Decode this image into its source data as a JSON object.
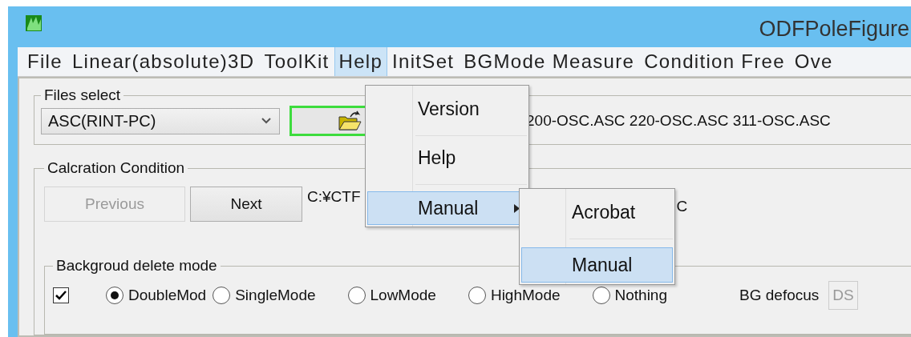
{
  "window": {
    "title": "ODFPoleFigure"
  },
  "menu_bar": [
    {
      "label": "File",
      "selected": false
    },
    {
      "label": "Linear(absolute)3D",
      "selected": false
    },
    {
      "label": "ToolKit",
      "selected": false
    },
    {
      "label": "Help",
      "selected": true
    },
    {
      "label": "InitSet",
      "selected": false
    },
    {
      "label": "BGMode Measure",
      "selected": false
    },
    {
      "label": "Condition Free",
      "selected": false
    },
    {
      "label": "Ove",
      "selected": false
    }
  ],
  "help_menu": [
    {
      "label": "Version",
      "selected": false,
      "submenu": false
    },
    {
      "label": "Help",
      "selected": false,
      "submenu": false
    },
    {
      "label": "Manual",
      "selected": true,
      "submenu": true
    }
  ],
  "manual_submenu": [
    {
      "label": "Acrobat",
      "selected": false
    },
    {
      "label": "Manual",
      "selected": true
    }
  ],
  "files_select": {
    "title": "Files select",
    "format": "ASC(RINT-PC)",
    "files": "200-OSC.ASC 220-OSC.ASC 311-OSC.ASC"
  },
  "calculation": {
    "title": "Calcration Condition",
    "buttons": [
      {
        "label": "Previous",
        "disabled": true
      },
      {
        "label": "Next",
        "disabled": false
      }
    ],
    "path_start": "C:¥CTF",
    "path_end": "C"
  },
  "background_mode": {
    "title": "Backgroud delete mode",
    "enabled": true,
    "options": [
      {
        "label": "DoubleMod",
        "selected": true
      },
      {
        "label": "SingleMode",
        "selected": false
      },
      {
        "label": "LowMode",
        "selected": false
      },
      {
        "label": "HighMode",
        "selected": false
      },
      {
        "label": "Nothing",
        "selected": false
      }
    ],
    "defocus_label": "BG defocus",
    "defocus_value": "DS",
    "defocus_disabled": true
  }
}
